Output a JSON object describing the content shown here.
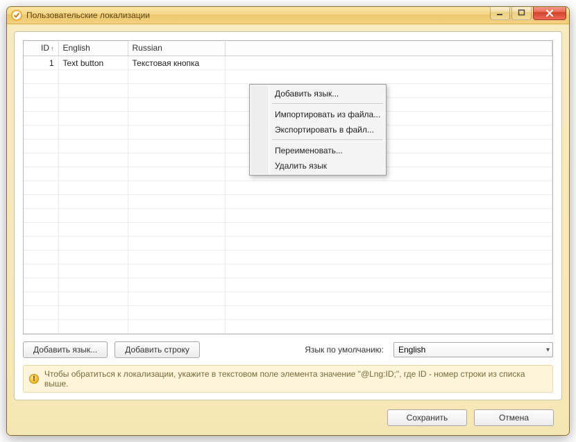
{
  "window": {
    "title": "Пользовательские локализации"
  },
  "table": {
    "columns": {
      "id": "ID",
      "english": "English",
      "russian": "Russian"
    },
    "rows": [
      {
        "id": "1",
        "english": "Text button",
        "russian": "Текстовая кнопка"
      }
    ]
  },
  "toolbar": {
    "add_lang": "Добавить язык...",
    "add_row": "Добавить строку",
    "default_lang_label": "Язык по умолчанию:",
    "default_lang_value": "English"
  },
  "hint": {
    "text": "Чтобы обратиться к локализации, укажите в текстовом поле элемента значение \"@Lng:ID;\", где ID - номер строки из списка выше."
  },
  "actions": {
    "save": "Сохранить",
    "cancel": "Отмена"
  },
  "context_menu": {
    "items": [
      "Добавить язык...",
      "Импортировать из файла...",
      "Экспортировать в файл...",
      "Переименовать...",
      "Удалить язык"
    ]
  }
}
